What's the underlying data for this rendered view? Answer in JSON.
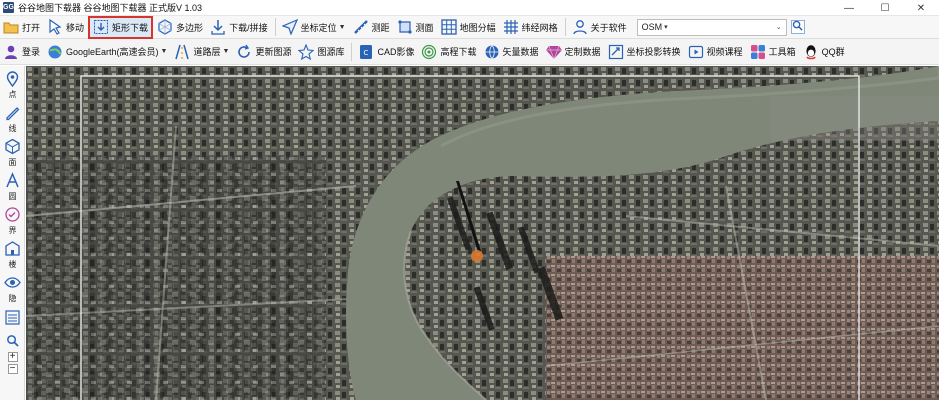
{
  "window": {
    "app_icon_text": "GG",
    "title": "谷谷地图下载器  谷谷地图下载器 正式版V 1.03",
    "minimize": "—",
    "maximize": "☐",
    "close": "✕"
  },
  "toolbar1": {
    "items": [
      {
        "label": "打开",
        "icon": "folder-open-icon"
      },
      {
        "label": "移动",
        "icon": "cursor-move-icon"
      },
      {
        "label": "矩形下载",
        "icon": "rect-download-icon",
        "highlighted": true
      },
      {
        "label": "多边形",
        "icon": "polygon-icon"
      },
      {
        "label": "下载/拼接",
        "icon": "download-merge-icon"
      },
      {
        "label": "坐标定位",
        "icon": "locate-icon",
        "dropdown": true
      },
      {
        "label": "测距",
        "icon": "ruler-icon"
      },
      {
        "label": "测面",
        "icon": "area-measure-icon"
      },
      {
        "label": "地图分幅",
        "icon": "grid-split-icon"
      },
      {
        "label": "纬经网格",
        "icon": "latlon-grid-icon"
      },
      {
        "label": "关于软件",
        "icon": "user-info-icon"
      }
    ],
    "map_source": {
      "selected": "OSM",
      "caret": "▾"
    }
  },
  "toolbar2": {
    "items": [
      {
        "label": "登录",
        "icon": "login-user-icon"
      },
      {
        "label": "GoogleEarth(高速会员)",
        "icon": "googleearth-icon",
        "dropdown": true
      },
      {
        "label": "道路层",
        "icon": "road-layer-icon",
        "dropdown": true
      },
      {
        "label": "更新图源",
        "icon": "refresh-source-icon"
      },
      {
        "label": "图源库",
        "icon": "source-library-icon"
      },
      {
        "label": "CAD影像",
        "icon": "cad-image-icon"
      },
      {
        "label": "高程下载",
        "icon": "elevation-icon"
      },
      {
        "label": "矢量数据",
        "icon": "vector-data-icon"
      },
      {
        "label": "定制数据",
        "icon": "custom-data-icon"
      },
      {
        "label": "坐标投影转换",
        "icon": "projection-convert-icon"
      },
      {
        "label": "视频课程",
        "icon": "video-course-icon"
      },
      {
        "label": "工具箱",
        "icon": "toolbox-icon"
      },
      {
        "label": "QQ群",
        "icon": "qq-icon"
      }
    ]
  },
  "sidebar": {
    "items": [
      {
        "label": "点",
        "icon": "point-pin-icon"
      },
      {
        "label": "线",
        "icon": "line-pen-icon"
      },
      {
        "label": "面",
        "icon": "polygon-face-icon"
      },
      {
        "label": "圆",
        "icon": "circle-a-icon"
      },
      {
        "label": "界",
        "icon": "boundary-icon"
      },
      {
        "label": "楼",
        "icon": "building-icon"
      },
      {
        "label": "隐",
        "icon": "hide-eye-icon"
      }
    ],
    "zoom_in": "+",
    "zoom_out": "−"
  },
  "colors": {
    "highlight_border": "#d6342c",
    "highlight_bg": "#dbe8f6",
    "river": "#7f8778",
    "land": "#4b4d49"
  }
}
